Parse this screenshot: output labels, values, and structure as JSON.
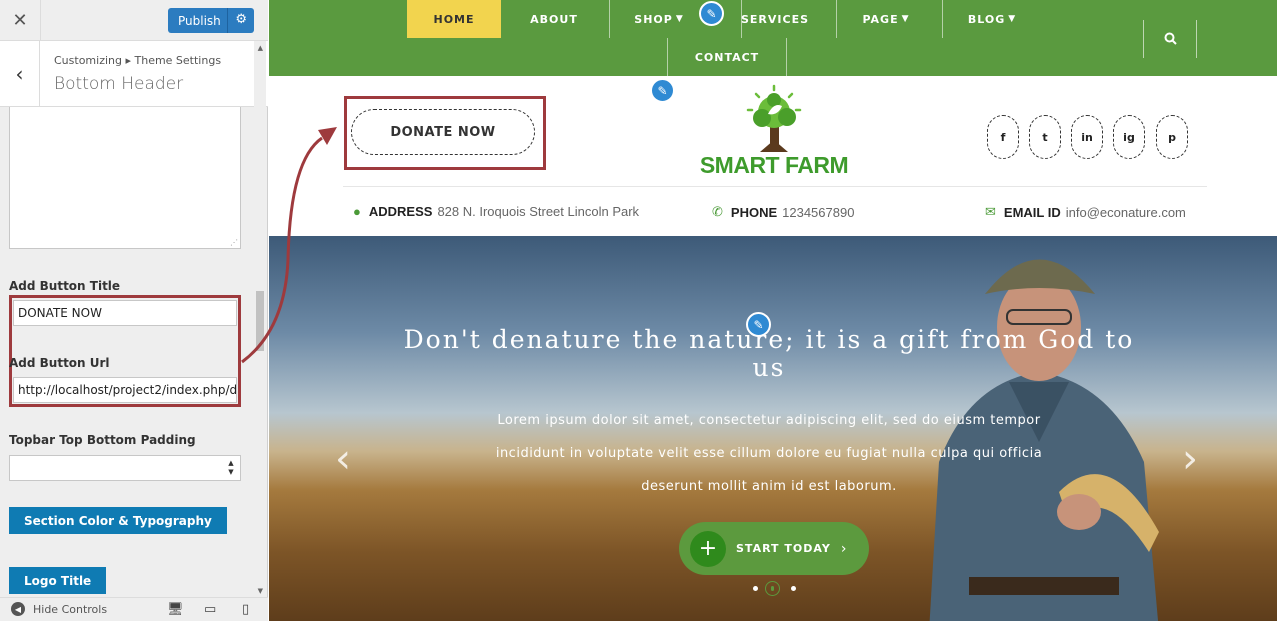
{
  "customizer": {
    "close_icon": "✕",
    "publish_label": "Publish",
    "breadcrumb": "Customizing ▸ Theme Settings",
    "section_title": "Bottom Header",
    "fields": {
      "button_title_label": "Add Button Title",
      "button_title_value": "DONATE NOW",
      "button_url_label": "Add Button Url",
      "button_url_value": "http://localhost/project2/index.php/d",
      "padding_label": "Topbar Top Bottom Padding",
      "padding_value": ""
    },
    "section_color_button": "Section Color & Typography",
    "logo_title_button": "Logo Title",
    "hide_controls": "Hide Controls",
    "accent_color": "#2c7cc0",
    "highlight_color": "#9e3a3d"
  },
  "site": {
    "nav": {
      "items": [
        "HOME",
        "ABOUT",
        "SHOP",
        "SERVICES",
        "PAGE",
        "BLOG",
        "CONTACT"
      ],
      "color": "#5a9a3f",
      "active_color": "#f2d44e"
    },
    "donate_label": "DONATE NOW",
    "logo_text": "SMART FARM",
    "social": [
      "f",
      "t",
      "in",
      "ig",
      "p"
    ],
    "contact": {
      "address_label": "ADDRESS",
      "address_value": "828 N. Iroquois Street Lincoln Park",
      "phone_label": "PHONE",
      "phone_value": "1234567890",
      "email_label": "EMAIL ID",
      "email_value": "info@econature.com"
    },
    "hero": {
      "title": "Don't denature the nature; it is a gift from God to us",
      "text": "Lorem ipsum dolor sit amet, consectetur adipiscing elit, sed do eiusm tempor incididunt in voluptate velit esse cillum dolore eu fugiat nulla culpa qui officia deserunt mollit anim id est laborum.",
      "cta": "START TODAY"
    }
  }
}
